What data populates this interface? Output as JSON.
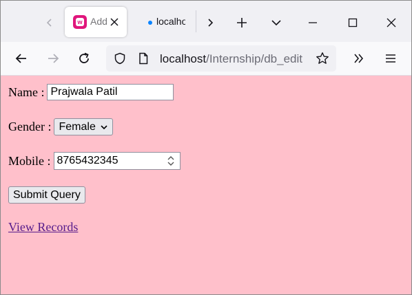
{
  "browser": {
    "active_tab_title": "Add",
    "inactive_tab_title": "localhost",
    "url_host": "localhost",
    "url_path": "/Internship/db_edit"
  },
  "form": {
    "name_label": "Name :",
    "name_value": "Prajwala Patil",
    "gender_label": "Gender :",
    "gender_value": "Female",
    "mobile_label": "Mobile :",
    "mobile_value": "8765432345",
    "submit_label": "Submit Query"
  },
  "links": {
    "view_records": "View Records"
  },
  "colors": {
    "page_background": "#ffc0cb",
    "visited_link": "#551a8b",
    "favicon": "#e0167c",
    "tab_dot": "#0a84ff"
  },
  "icons": [
    "tab-scroll-left-icon",
    "app-favicon-icon",
    "tab-close-icon",
    "tab-loading-dot-icon",
    "tab-scroll-right-icon",
    "new-tab-icon",
    "list-tabs-icon",
    "minimize-icon",
    "maximize-icon",
    "window-close-icon",
    "back-icon",
    "forward-icon",
    "reload-icon",
    "shield-icon",
    "page-icon",
    "bookmark-star-icon",
    "overflow-chevron-icon",
    "menu-icon",
    "chevron-down-icon",
    "spinner-arrows-icon"
  ]
}
